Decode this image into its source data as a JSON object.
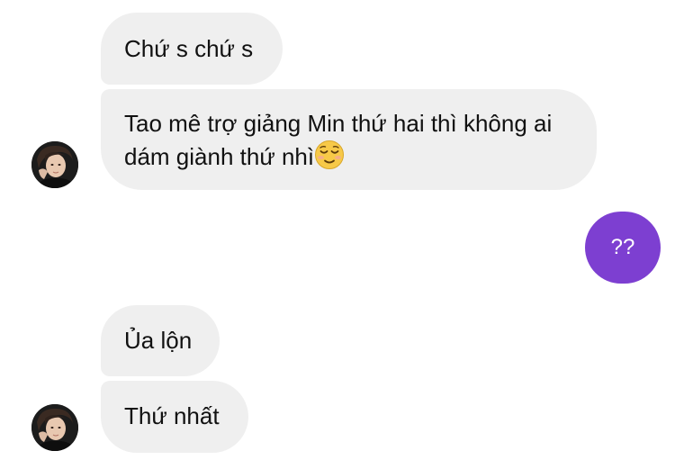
{
  "conversation": {
    "messages": [
      {
        "sender": "other",
        "text": "Chứ s chứ s"
      },
      {
        "sender": "other",
        "text": "Tao mê trợ giảng Min thứ hai thì không ai dám giành thứ nhì",
        "emoji": "relieved-face"
      },
      {
        "sender": "me",
        "text": "??"
      },
      {
        "sender": "other",
        "text": "Ủa lộn"
      },
      {
        "sender": "other",
        "text": "Thứ nhất"
      }
    ]
  },
  "colors": {
    "incoming_bubble": "#efefef",
    "outgoing_bubble": "#7d3fd1",
    "text": "#111111",
    "outgoing_text": "#ffffff",
    "emoji_face": "#f7c948"
  }
}
